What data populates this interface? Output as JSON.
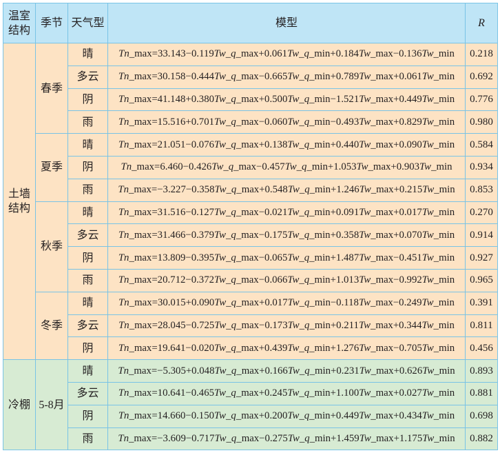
{
  "header": {
    "structure_lines": [
      "温室",
      "结构"
    ],
    "season": "季节",
    "weather": "天气型",
    "model": "模型",
    "r": "R"
  },
  "groups": [
    {
      "structure_lines": [
        "土墙",
        "结构"
      ],
      "seasons": [
        {
          "season": "春季",
          "rows": [
            {
              "weather": "晴",
              "model": "Tn_max=33.143−0.119Tw_q_max+0.061Tw_q_min+0.184Tw_max−0.136Tw_min",
              "r": "0.218"
            },
            {
              "weather": "多云",
              "model": "Tn_max=30.158−0.444Tw_q_max−0.665Tw_q_min+0.789Tw_max+0.061Tw_min",
              "r": "0.692"
            },
            {
              "weather": "阴",
              "model": "Tn_max=41.148+0.380Tw_q_max+0.500Tw_q_min−1.521Tw_max+0.449Tw_min",
              "r": "0.776"
            },
            {
              "weather": "雨",
              "model": "Tn_max=15.516+0.701Tw_q_max−0.060Tw_q_min−0.493Tw_max+0.829Tw_min",
              "r": "0.980"
            }
          ]
        },
        {
          "season": "夏季",
          "rows": [
            {
              "weather": "晴",
              "model": "Tn_max=21.051−0.076Tw_q_max+0.138Tw_q_min+0.440Tw_max+0.090Tw_min",
              "r": "0.584"
            },
            {
              "weather": "阴",
              "model": "Tn_max=6.460−0.426Tw_q_max−0.457Tw_q_min+1.053Tw_max+0.903Tw_min",
              "r": "0.934"
            },
            {
              "weather": "雨",
              "model": "Tn_max=−3.227−0.358Tw_q_max+0.548Tw_q_min+1.246Tw_max+0.215Tw_min",
              "r": "0.853"
            }
          ]
        },
        {
          "season": "秋季",
          "rows": [
            {
              "weather": "晴",
              "model": "Tn_max=31.516−0.127Tw_q_max−0.021Tw_q_min+0.091Tw_max+0.017Tw_min",
              "r": "0.270"
            },
            {
              "weather": "多云",
              "model": "Tn_max=31.466−0.379Tw_q_max−0.175Tw_q_min+0.358Tw_max+0.070Tw_min",
              "r": "0.914"
            },
            {
              "weather": "阴",
              "model": "Tn_max=13.809−0.395Tw_q_max−0.065Tw_q_min+1.487Tw_max−0.451Tw_min",
              "r": "0.927"
            },
            {
              "weather": "雨",
              "model": "Tn_max=20.712−0.372Tw_q_max−0.066Tw_q_min+1.013Tw_max−0.992Tw_min",
              "r": "0.965"
            }
          ]
        },
        {
          "season": "冬季",
          "rows": [
            {
              "weather": "晴",
              "model": "Tn_max=30.015+0.090Tw_q_max+0.017Tw_q_min−0.118Tw_max−0.249Tw_min",
              "r": "0.391"
            },
            {
              "weather": "多云",
              "model": "Tn_max=28.045−0.725Tw_q_max−0.173Tw_q_min+0.211Tw_max+0.344Tw_min",
              "r": "0.811"
            },
            {
              "weather": "阴",
              "model": "Tn_max=19.641−0.020Tw_q_max+0.439Tw_q_min+1.276Tw_max−0.705Tw_min",
              "r": "0.456"
            }
          ]
        }
      ]
    },
    {
      "structure_lines": [
        "冷棚"
      ],
      "seasons": [
        {
          "season": "5-8月",
          "rows": [
            {
              "weather": "晴",
              "model": "Tn_max=−5.305+0.048Tw_q_max+0.166Tw_q_min+0.231Tw_max+0.626Tw_min",
              "r": "0.893"
            },
            {
              "weather": "多云",
              "model": "Tn_max=10.641−0.465Tw_q_max+0.245Tw_q_min+1.100Tw_max+0.027Tw_min",
              "r": "0.881"
            },
            {
              "weather": "阴",
              "model": "Tn_max=14.660−0.150Tw_q_max+0.200Tw_q_min+0.449Tw_max+0.434Tw_min",
              "r": "0.698"
            },
            {
              "weather": "雨",
              "model": "Tn_max=−3.609−0.717Tw_q_max−0.275Tw_q_min+1.459Tw_max+1.175Tw_min",
              "r": "0.882"
            }
          ]
        }
      ]
    }
  ],
  "colors": {
    "header_bg": "#bfe5f6",
    "border": "#78c3e6",
    "soil_wall_bg": "#fde3c4",
    "cold_shed_bg": "#d7ebd3",
    "text": "#231f20"
  }
}
